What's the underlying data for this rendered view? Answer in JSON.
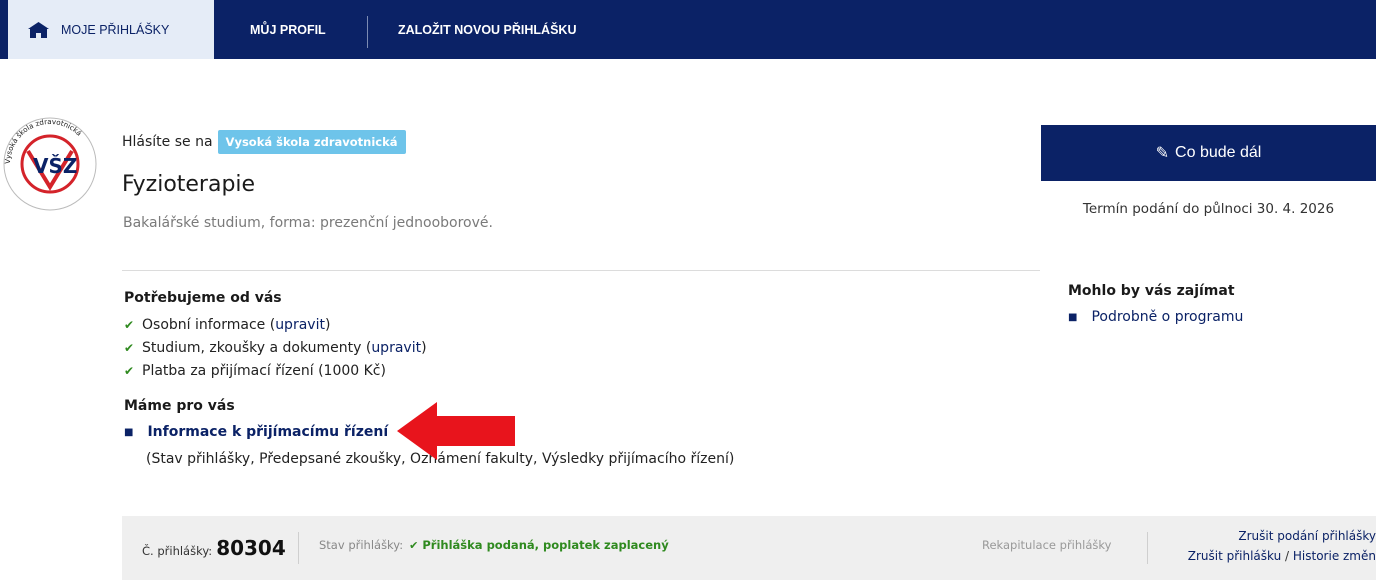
{
  "nav": {
    "tabs": [
      {
        "label": "MOJE PŘIHLÁŠKY",
        "active": true
      },
      {
        "label": "MŮJ PROFIL",
        "active": false
      },
      {
        "label": "ZALOŽIT NOVOU PŘIHLÁŠKU",
        "active": false
      }
    ]
  },
  "application": {
    "applying_text": "Hlásíte se na",
    "school": "Vysoká škola zdravotnická",
    "program": "Fyzioterapie",
    "subtitle": "Bakalářské studium, forma: prezenční jednooborové."
  },
  "needs": {
    "heading": "Potřebujeme od vás",
    "items": [
      {
        "text": "Osobní informace (",
        "link": "upravit",
        "after": ")"
      },
      {
        "text": "Studium, zkoušky a dokumenty (",
        "link": "upravit",
        "after": ")"
      },
      {
        "text": "Platba za přijímací řízení (1000 Kč)",
        "link": "",
        "after": ""
      }
    ]
  },
  "for_you": {
    "heading": "Máme pro vás",
    "link": "Informace k přijímacímu řízení",
    "description": "(Stav přihlášky, Předepsané zkoušky, Oznámení fakulty, Výsledky přijímacího řízení)"
  },
  "sidebar": {
    "next_button": "Co bude dál",
    "deadline": "Termín podání do půlnoci 30. 4. 2026",
    "interest_heading": "Mohlo by vás zajímat",
    "interest_link": "Podrobně o programu"
  },
  "footer": {
    "app_no_label": "Č. přihlášky:",
    "app_no": "80304",
    "state_label": "Stav přihlášky:",
    "state_value": "Přihláška podaná, poplatek zaplacený",
    "recap": "Rekapitulace přihlášky",
    "cancel_submit": "Zrušit podání přihlášky",
    "cancel_app": "Zrušit přihlášku",
    "separator": " / ",
    "history": "Historie změn"
  },
  "logo": {
    "text_circle": "Vysoká škola zdravotnická",
    "letters": "VŠZ"
  },
  "colors": {
    "nav_bg": "#0b2266",
    "active_tab_bg": "#e5ecf7",
    "badge": "#6ec4ea",
    "check": "#2f8a1f",
    "arrow": "#e8141c"
  }
}
